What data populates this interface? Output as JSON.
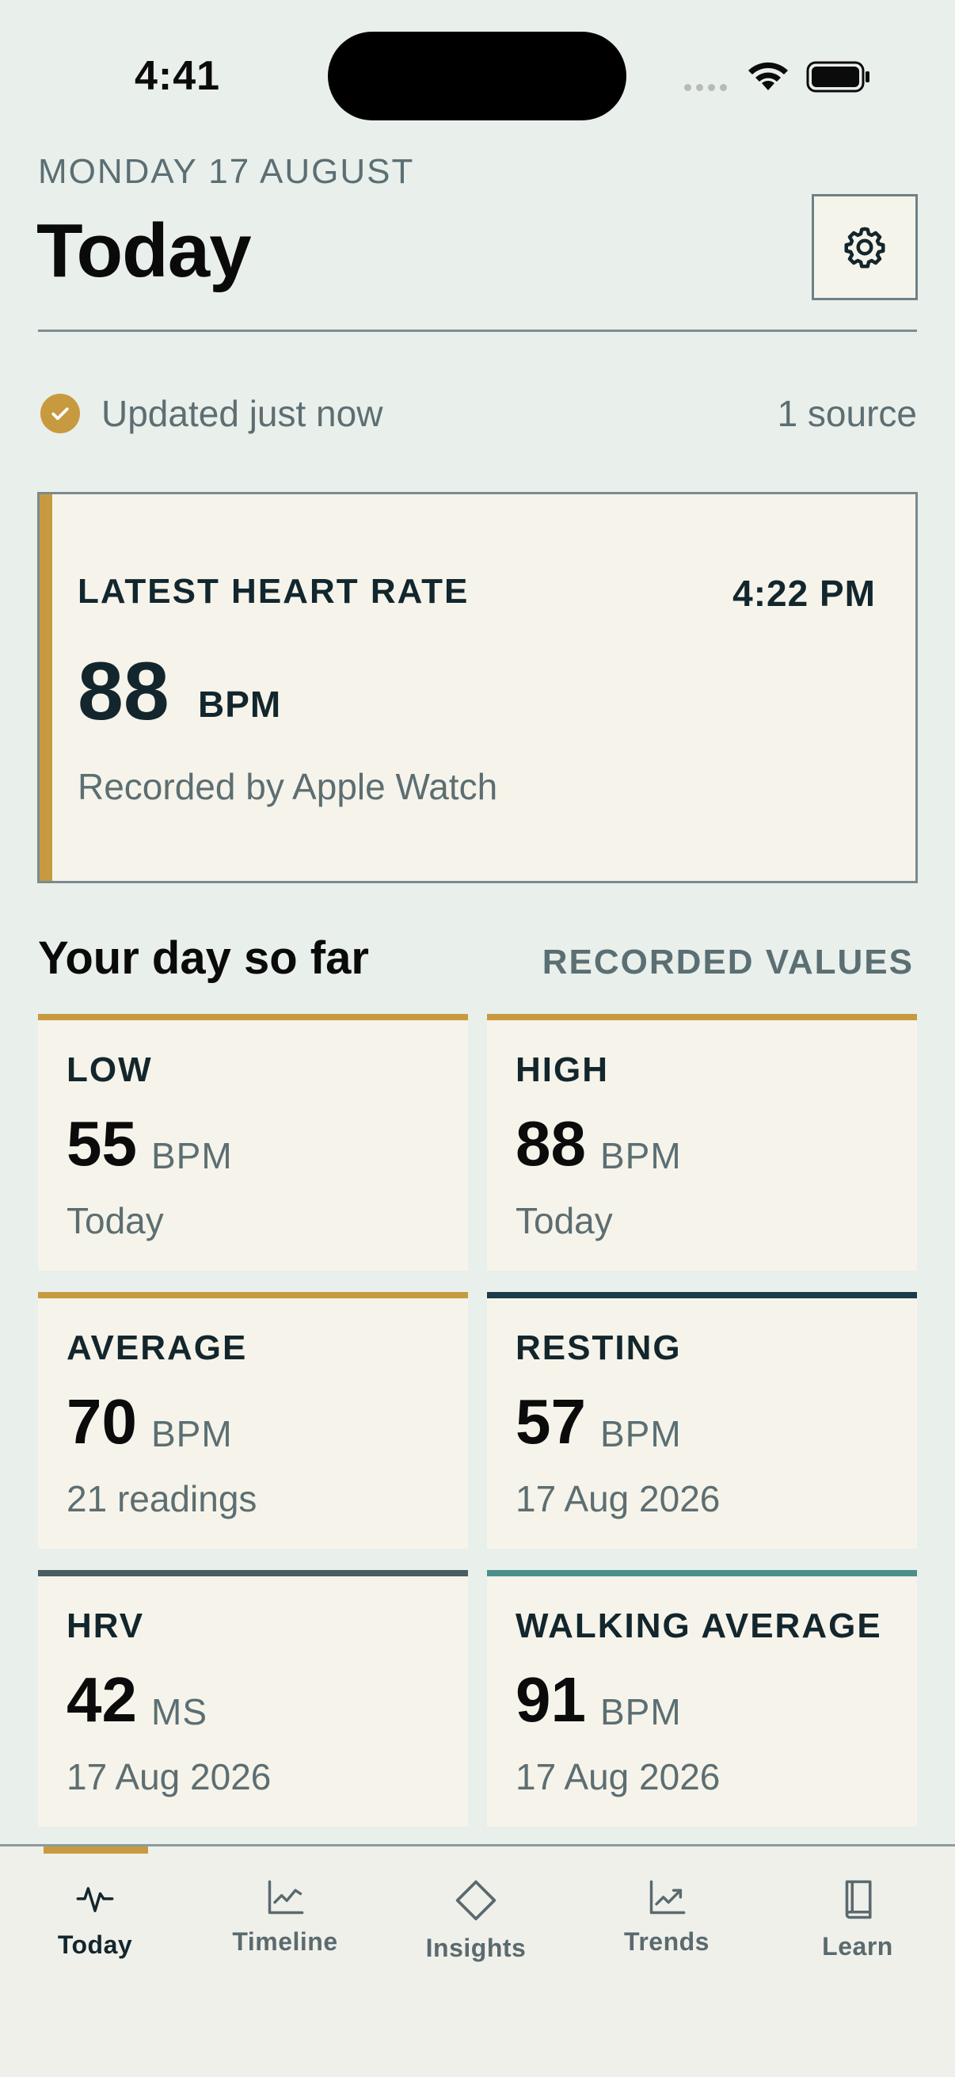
{
  "status_bar": {
    "time": "4:41"
  },
  "header": {
    "date": "MONDAY 17 AUGUST",
    "title": "Today",
    "settings_icon": "gear-icon"
  },
  "sync": {
    "status": "Updated just now",
    "sources": "1 source",
    "icon": "check-circle-icon"
  },
  "latest": {
    "title": "LATEST HEART RATE",
    "time": "4:22 PM",
    "value": "88",
    "unit": "BPM",
    "note": "Recorded by Apple Watch"
  },
  "section": {
    "title": "Your day so far",
    "tag": "RECORDED VALUES"
  },
  "stats": [
    {
      "label": "LOW",
      "value": "55",
      "unit": "BPM",
      "sub": "Today",
      "accent": "#c89a3f"
    },
    {
      "label": "HIGH",
      "value": "88",
      "unit": "BPM",
      "sub": "Today",
      "accent": "#c89a3f"
    },
    {
      "label": "AVERAGE",
      "value": "70",
      "unit": "BPM",
      "sub": "21 readings",
      "accent": "#c89a3f"
    },
    {
      "label": "RESTING",
      "value": "57",
      "unit": "BPM",
      "sub": "17 Aug 2026",
      "accent": "#1b3a4b"
    },
    {
      "label": "HRV",
      "value": "42",
      "unit": "MS",
      "sub": "17 Aug 2026",
      "accent": "#4a5d63"
    },
    {
      "label": "WALKING AVERAGE",
      "value": "91",
      "unit": "BPM",
      "sub": "17 Aug 2026",
      "accent": "#4b8f8c"
    }
  ],
  "tabs": [
    {
      "label": "Today",
      "icon": "heartbeat-icon",
      "active": true
    },
    {
      "label": "Timeline",
      "icon": "line-chart-icon",
      "active": false
    },
    {
      "label": "Insights",
      "icon": "diamond-icon",
      "active": false
    },
    {
      "label": "Trends",
      "icon": "trend-up-icon",
      "active": false
    },
    {
      "label": "Learn",
      "icon": "book-icon",
      "active": false
    }
  ],
  "colors": {
    "background": "#e9efeb",
    "card": "#f6f4ea",
    "accent": "#c89a3f",
    "ink": "#13262d",
    "muted": "#5d6e72"
  }
}
